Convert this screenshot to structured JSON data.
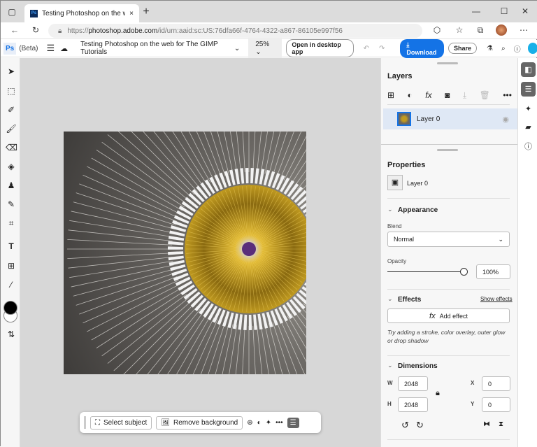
{
  "browser": {
    "tab_title": "Testing Photoshop on the web fo",
    "url_prefix": "https://",
    "url_host": "photoshop.adobe.com",
    "url_path": "/id/urn:aaid:sc:US:76dfa66f-4764-4322-a867-86105e997f56",
    "new_tab": "+",
    "close": "×",
    "minimize": "—",
    "maximize": "☐",
    "close_window": "✕"
  },
  "app": {
    "logo": "Ps",
    "beta": "(Beta)",
    "doc_title": "Testing Photoshop on the web for The GIMP Tutorials",
    "zoom": "25%",
    "open_desktop": "Open in desktop app",
    "download": "Download",
    "share": "Share"
  },
  "floatbar": {
    "select_subject": "Select subject",
    "remove_background": "Remove background",
    "more": "•••"
  },
  "layers": {
    "title": "Layers",
    "more": "•••",
    "items": [
      {
        "name": "Layer 0"
      }
    ]
  },
  "properties": {
    "title": "Properties",
    "layer_name": "Layer 0",
    "appearance": {
      "title": "Appearance",
      "blend_label": "Blend",
      "blend": "Normal",
      "opacity_label": "Opacity",
      "opacity": "100%",
      "opacity_value": 100
    },
    "effects": {
      "title": "Effects",
      "show": "Show effects",
      "add": "Add effect",
      "hint": "Try adding a stroke, color overlay, outer glow or drop shadow"
    },
    "dimensions": {
      "title": "Dimensions",
      "w_label": "W",
      "w": "2048",
      "h_label": "H",
      "h": "2048",
      "x_label": "X",
      "x": "0",
      "y_label": "Y",
      "y": "0"
    }
  },
  "colors": {
    "accent": "#1473e6",
    "foreground": "#000000",
    "background": "#ffffff"
  }
}
